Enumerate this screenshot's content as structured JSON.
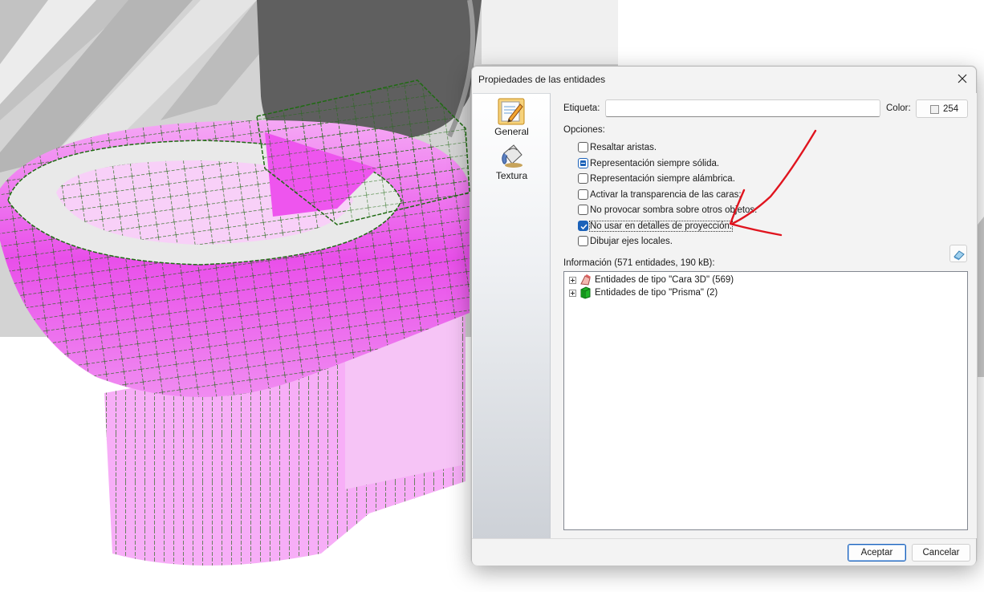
{
  "dialog": {
    "title": "Propiedades de las entidades",
    "close_icon": "close-icon"
  },
  "sidebar": {
    "items": [
      {
        "label": "General",
        "icon": "notepad-pencil-icon",
        "selected": true
      },
      {
        "label": "Textura",
        "icon": "paint-bucket-icon",
        "selected": false
      }
    ]
  },
  "general": {
    "etiqueta_label": "Etiqueta:",
    "etiqueta_value": "",
    "color_label": "Color:",
    "color_value": "254",
    "opciones_label": "Opciones:",
    "options": [
      {
        "label": "Resaltar aristas.",
        "state": "unchecked"
      },
      {
        "label": "Representación siempre sólida.",
        "state": "indeterminate"
      },
      {
        "label": "Representación siempre alámbrica.",
        "state": "unchecked"
      },
      {
        "label": "Activar la transparencia de las caras:",
        "state": "unchecked"
      },
      {
        "label": "No provocar sombra sobre otros objetos.",
        "state": "unchecked"
      },
      {
        "label": "No usar en detalles de proyección.",
        "state": "checked"
      },
      {
        "label": "Dibujar ejes locales.",
        "state": "unchecked"
      }
    ],
    "info_label": "Información (571 entidades, 190 kB):",
    "tree": [
      {
        "label": "Entidades de tipo \"Cara 3D\" (569)",
        "icon": "face-3d-icon"
      },
      {
        "label": "Entidades de tipo \"Prisma\" (2)",
        "icon": "prism-icon"
      }
    ]
  },
  "footer": {
    "accept_label": "Aceptar",
    "cancel_label": "Cancelar"
  },
  "colors": {
    "accent": "#1c62b9",
    "annotation_arrow": "#e0141e",
    "model_magenta": "#ee6cf0",
    "wireframe_green": "#1f6b12"
  }
}
